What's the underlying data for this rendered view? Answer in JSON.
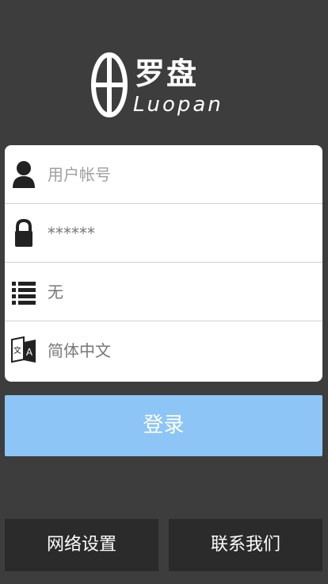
{
  "logo": {
    "cn": "罗盘",
    "en": "Luopan"
  },
  "form": {
    "username_placeholder": "用户帐号",
    "password_value": "******",
    "server_value": "无",
    "language_value": "简体中文"
  },
  "buttons": {
    "login": "登录",
    "network_settings": "网络设置",
    "contact_us": "联系我们"
  },
  "colors": {
    "background": "#3d3d3d",
    "login_button": "#8cc5f6",
    "bottom_button": "#2b2b2b"
  }
}
